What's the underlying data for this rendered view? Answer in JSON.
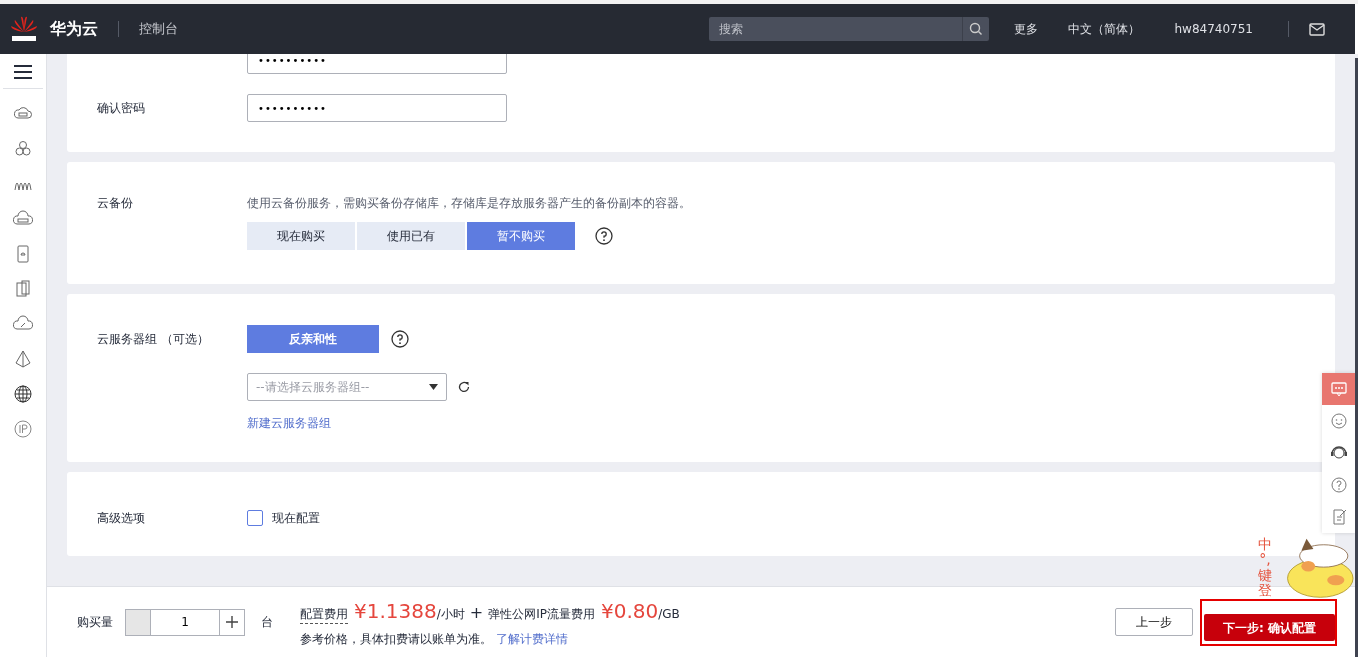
{
  "header": {
    "brand": "华为云",
    "console": "控制台",
    "search": {
      "placeholder": "搜索"
    },
    "links": [
      "更多",
      "中文（简体）",
      "hw84740751"
    ]
  },
  "password_rows": [
    {
      "value": "••••••••••"
    },
    {
      "label": "确认密码",
      "value": "••••••••••"
    }
  ],
  "backup": {
    "label": "云备份",
    "description": "使用云备份服务，需购买备份存储库，存储库是存放服务器产生的备份副本的容器。",
    "options": [
      {
        "label": "现在购买",
        "selected": false
      },
      {
        "label": "使用已有",
        "selected": false
      },
      {
        "label": "暂不购买",
        "selected": true
      }
    ]
  },
  "server_group": {
    "label": "云服务器组 （可选）",
    "options": [
      {
        "label": "反亲和性",
        "selected": true
      }
    ],
    "select": {
      "placeholder": "--请选择云服务器组--"
    },
    "link": "新建云服务器组"
  },
  "advanced": {
    "label": "高级选项",
    "checkbox": {
      "label": "现在配置",
      "checked": false
    }
  },
  "float_tools": [
    {
      "kind": "chat",
      "selected": true
    },
    {
      "kind": "smile",
      "selected": false
    },
    {
      "kind": "headset",
      "selected": false
    },
    {
      "kind": "help",
      "selected": false
    },
    {
      "kind": "edit",
      "selected": false
    }
  ],
  "ime": {
    "labels": [
      "中",
      "°,",
      "键",
      "登"
    ]
  },
  "footer": {
    "quantity_label": "购买量",
    "quantity": "1",
    "unit": "台",
    "fee_label": "配置费用",
    "price": "¥1.1388",
    "price_unit": "/小时",
    "plus": "+",
    "ip_fee_label": "弹性公网IP流量费用",
    "ip_price": "¥0.80",
    "ip_unit": "/GB",
    "note": "参考价格，具体扣费请以账单为准。",
    "note_link": "了解计费详情",
    "prev": "上一步",
    "next": {
      "label": "下一步: 确认配置",
      "highlighted": true
    }
  }
}
